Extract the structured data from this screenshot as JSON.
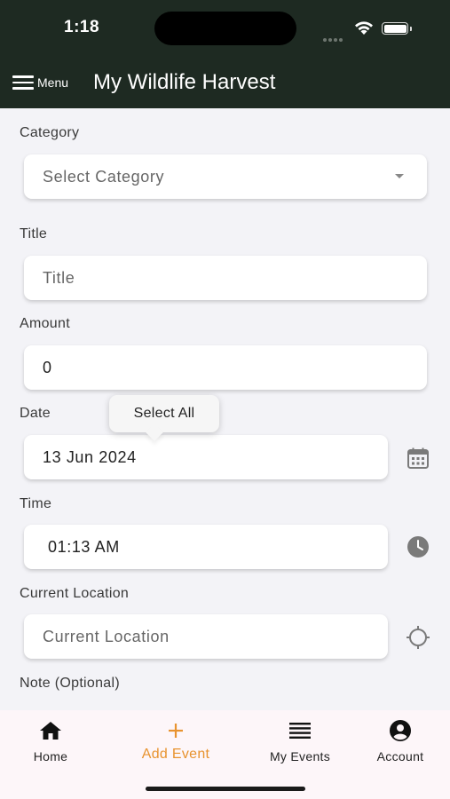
{
  "status_bar": {
    "time": "1:18"
  },
  "header": {
    "menu_label": "Menu",
    "title": "My Wildlife Harvest",
    "background": "#1e2a22"
  },
  "form": {
    "category": {
      "label": "Category",
      "placeholder": "Select Category"
    },
    "title": {
      "label": "Title",
      "placeholder": "Title"
    },
    "amount": {
      "label": "Amount",
      "value": "0"
    },
    "date": {
      "label": "Date",
      "value": "13 Jun 2024",
      "icon": "calendar-icon"
    },
    "time": {
      "label": "Time",
      "value": "01:13 AM",
      "icon": "clock-icon"
    },
    "location": {
      "label": "Current Location",
      "placeholder": "Current Location",
      "icon": "crosshair-icon"
    },
    "note": {
      "label": "Note (Optional)"
    }
  },
  "tooltip": {
    "label": "Select All"
  },
  "bottom_nav": {
    "accent": "#e8932f",
    "items": [
      {
        "label": "Home",
        "icon": "home-icon"
      },
      {
        "label": "Add Event",
        "icon": "plus-icon",
        "active": true
      },
      {
        "label": "My Events",
        "icon": "list-icon"
      },
      {
        "label": "Account",
        "icon": "account-icon"
      }
    ]
  }
}
